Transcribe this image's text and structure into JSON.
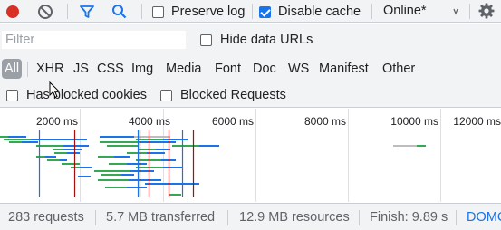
{
  "toolbar": {
    "preserve_log_label": "Preserve log",
    "preserve_log_checked": false,
    "disable_cache_label": "Disable cache",
    "disable_cache_checked": true,
    "throttling_value": "Online*",
    "icons": [
      "record-icon",
      "clear-icon",
      "filter-icon",
      "search-icon",
      "chevron-down-icon",
      "gear-icon"
    ],
    "record_color": "#d93025",
    "accent_color": "#1a73e8"
  },
  "filter": {
    "placeholder": "Filter",
    "hide_data_urls_label": "Hide data URLs"
  },
  "type_filters": [
    "All",
    "XHR",
    "JS",
    "CSS",
    "Img",
    "Media",
    "Font",
    "Doc",
    "WS",
    "Manifest",
    "Other"
  ],
  "type_filter_active": "All",
  "blocked": {
    "has_blocked_cookies_label": "Has blocked cookies",
    "blocked_requests_label": "Blocked Requests"
  },
  "timeline": {
    "tick_labels": [
      "2000 ms",
      "4000 ms",
      "6000 ms",
      "8000 ms",
      "10000 ms",
      "12000 ms"
    ],
    "marker_colors": {
      "dom_content_loaded": "#1a73e8",
      "load": "#a50e0e"
    }
  },
  "status": {
    "requests": "283 requests",
    "transferred": "5.7 MB transferred",
    "resources": "12.9 MB resources",
    "finish": "Finish: 9.89 s",
    "dom_loaded": "DOMC"
  }
}
